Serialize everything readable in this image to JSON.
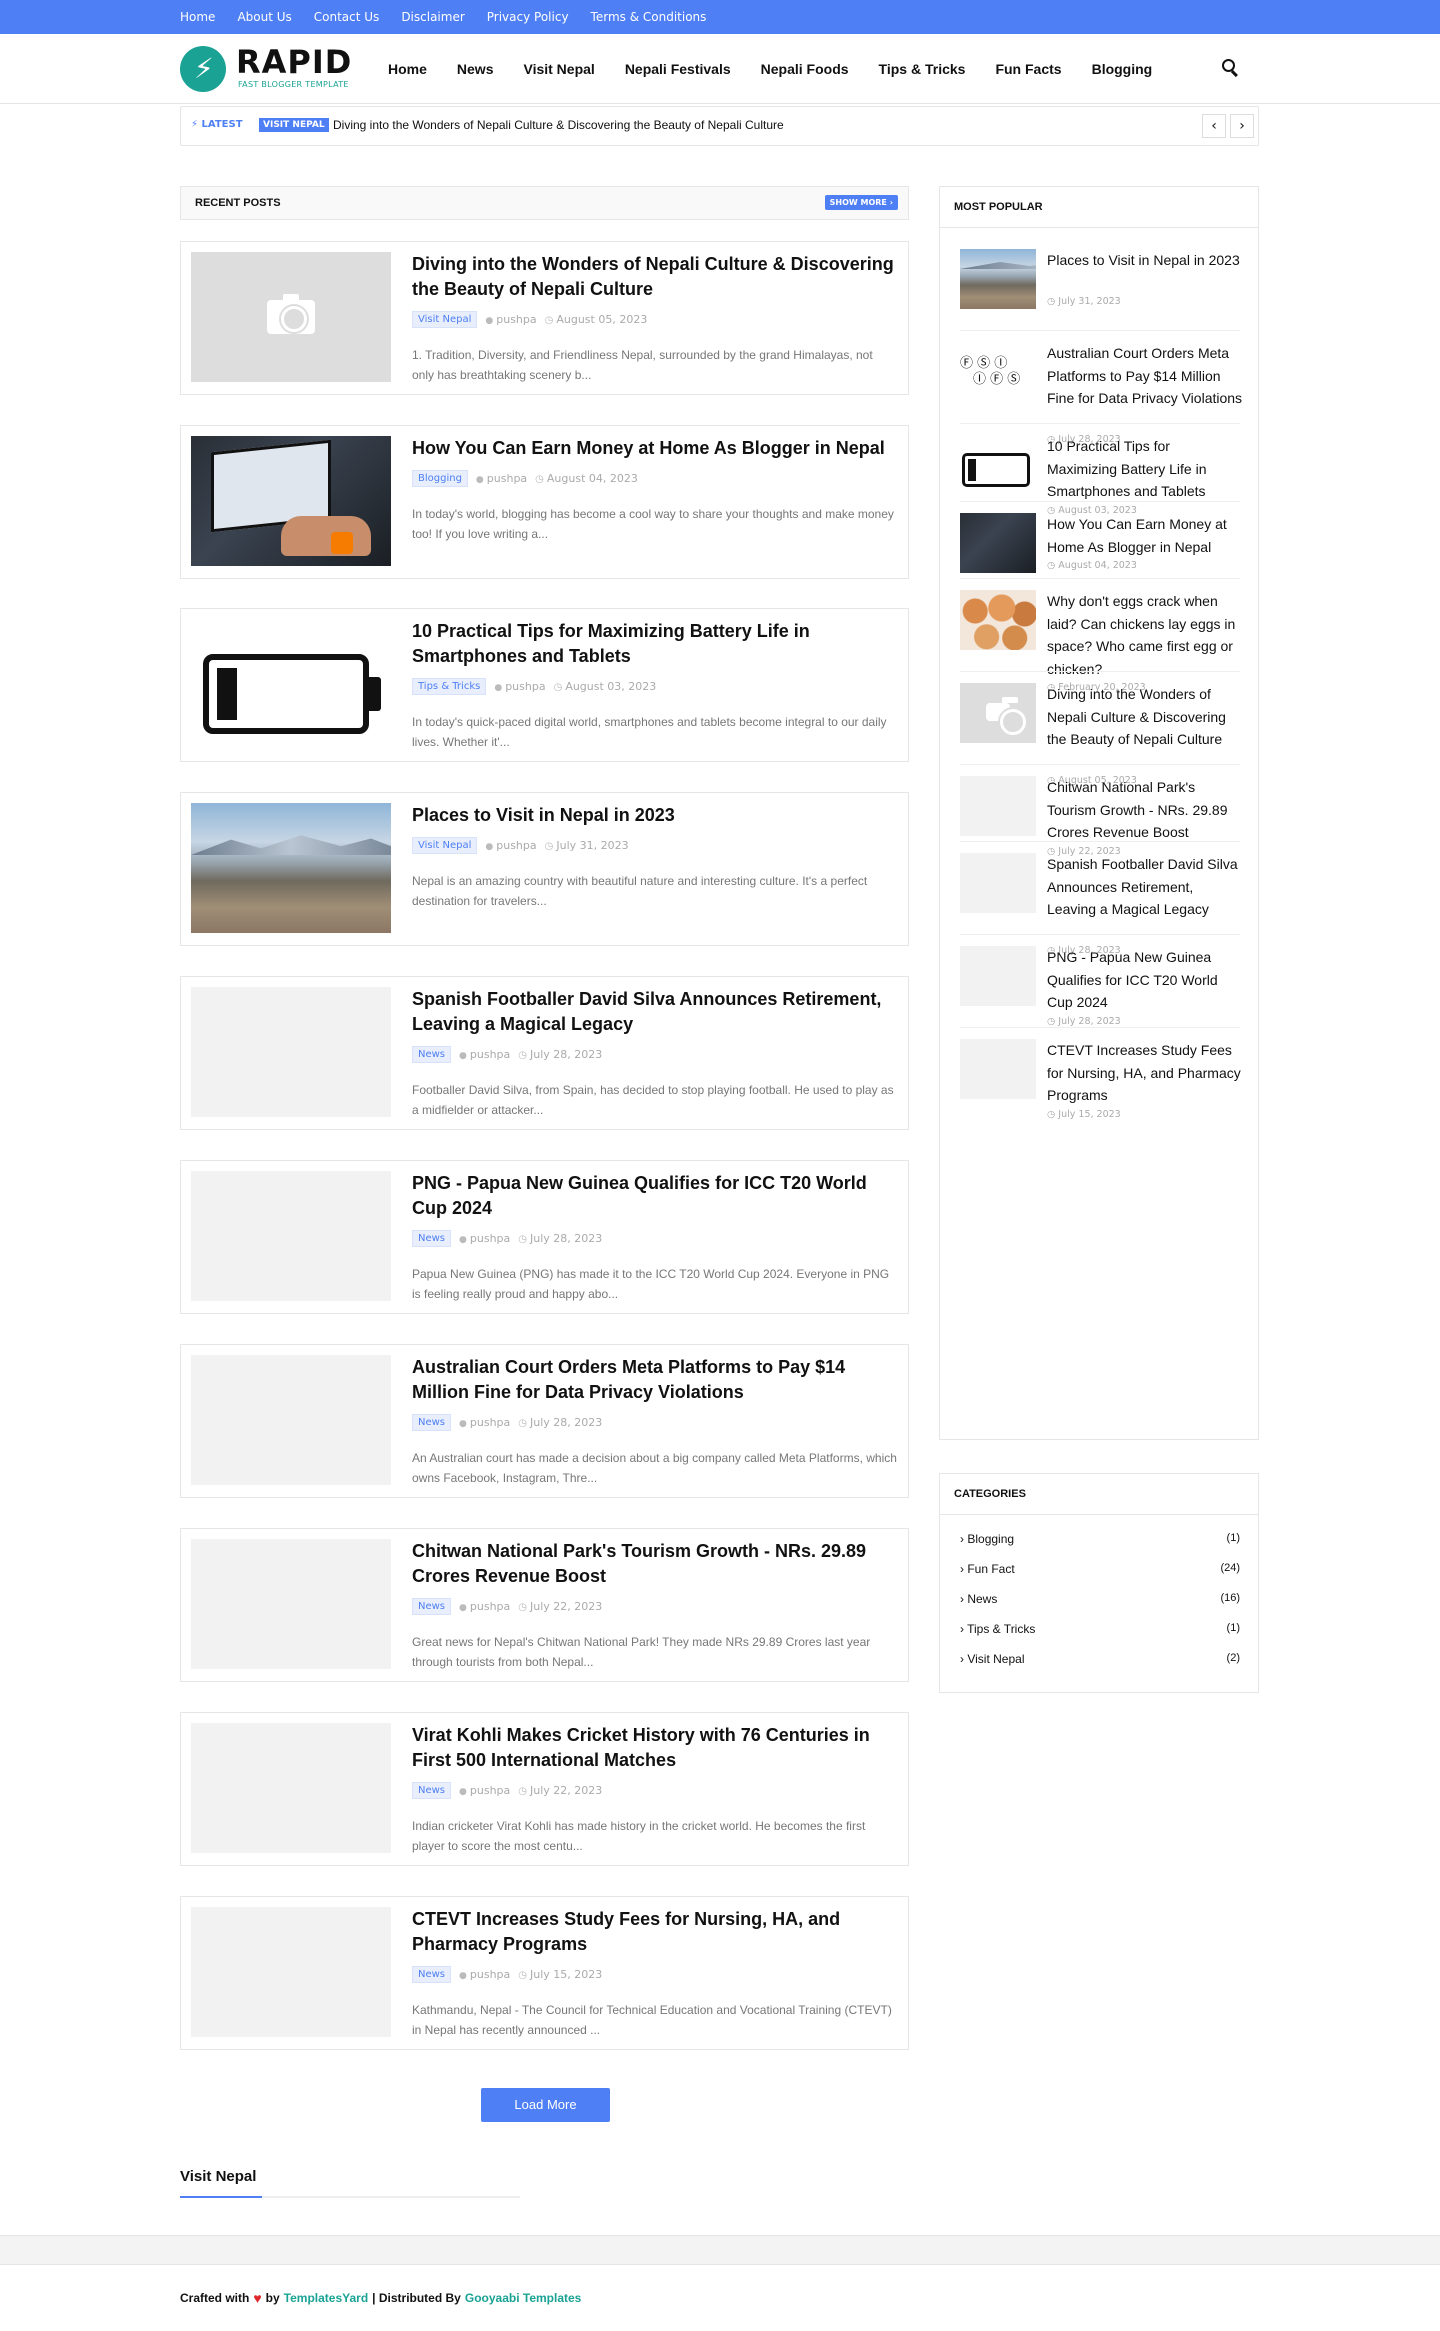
{
  "topbar": {
    "links": [
      "Home",
      "About Us",
      "Contact Us",
      "Disclaimer",
      "Privacy Policy",
      "Terms & Conditions"
    ]
  },
  "logo": {
    "title": "RAPID",
    "tagline": "FAST BLOGGER TEMPLATE"
  },
  "nav": {
    "items": [
      "Home",
      "News",
      "Visit Nepal",
      "Nepali Festivals",
      "Nepali Foods",
      "Tips & Tricks",
      "Fun Facts",
      "Blogging"
    ]
  },
  "ticker": {
    "latest_label": "LATEST",
    "tag": "VISIT NEPAL",
    "headline": "Diving into the Wonders of Nepali Culture & Discovering the Beauty of Nepali Culture",
    "prev_icon": "chevron-left-icon",
    "next_icon": "chevron-right-icon"
  },
  "recent": {
    "heading": "RECENT POSTS",
    "show_more": "SHOW MORE",
    "posts": [
      {
        "title": "Diving into the Wonders of Nepali Culture & Discovering the Beauty of Nepali Culture",
        "category": "Visit Nepal",
        "author": "pushpa",
        "date": "August 05, 2023",
        "snippet": "1. Tradition, Diversity, and Friendliness Nepal, surrounded by the grand Himalayas, not only has breathtaking scenery b...",
        "thumb": "camera-placeholder"
      },
      {
        "title": "How You Can Earn Money at Home As Blogger in Nepal",
        "category": "Blogging",
        "author": "pushpa",
        "date": "August 04, 2023",
        "snippet": "In today's world, blogging has become a cool way to share your thoughts and make money too! If you love writing a...",
        "thumb": "laptop"
      },
      {
        "title": "10 Practical Tips for Maximizing Battery Life in Smartphones and Tablets",
        "category": "Tips & Tricks",
        "author": "pushpa",
        "date": "August 03, 2023",
        "snippet": "In today's quick-paced digital world, smartphones and tablets become integral to our daily lives. Whether it'...",
        "thumb": "battery"
      },
      {
        "title": "Places to Visit in Nepal in 2023",
        "category": "Visit Nepal",
        "author": "pushpa",
        "date": "July 31, 2023",
        "snippet": "Nepal is an amazing country with beautiful nature and interesting culture. It's a perfect destination for travelers...",
        "thumb": "kathmandu"
      },
      {
        "title": "Spanish Footballer David Silva Announces Retirement, Leaving a Magical Legacy",
        "category": "News",
        "author": "pushpa",
        "date": "July 28, 2023",
        "snippet": "Footballer David Silva, from Spain, has decided to stop playing football. He used to play as a midfielder or attacker...",
        "thumb": "blank"
      },
      {
        "title": "PNG - Papua New Guinea Qualifies for ICC T20 World Cup 2024",
        "category": "News",
        "author": "pushpa",
        "date": "July 28, 2023",
        "snippet": "Papua New Guinea (PNG) has made it to the ICC T20 World Cup 2024. Everyone in PNG is feeling really proud and happy abo...",
        "thumb": "blank"
      },
      {
        "title": "Australian Court Orders Meta Platforms to Pay $14 Million Fine for Data Privacy Violations",
        "category": "News",
        "author": "pushpa",
        "date": "July 28, 2023",
        "snippet": "An Australian court has made a decision about a big company called Meta Platforms, which owns Facebook, Instagram, Thre...",
        "thumb": "blank"
      },
      {
        "title": "Chitwan National Park's Tourism Growth - NRs. 29.89 Crores Revenue Boost",
        "category": "News",
        "author": "pushpa",
        "date": "July 22, 2023",
        "snippet": "Great news for Nepal's Chitwan National Park! They made NRs 29.89 Crores last year through tourists from both Nepal...",
        "thumb": "blank"
      },
      {
        "title": "Virat Kohli Makes Cricket History with 76 Centuries in First 500 International Matches",
        "category": "News",
        "author": "pushpa",
        "date": "July 22, 2023",
        "snippet": "Indian cricketer Virat Kohli has made history in the cricket world. He becomes the first player to score the most centu...",
        "thumb": "blank"
      },
      {
        "title": "CTEVT Increases Study Fees for Nursing, HA, and Pharmacy Programs",
        "category": "News",
        "author": "pushpa",
        "date": "July 15, 2023",
        "snippet": "Kathmandu, Nepal - The Council for Technical Education and Vocational Training (CTEVT) in Nepal has recently announced ...",
        "thumb": "blank"
      }
    ]
  },
  "popular": {
    "heading": "MOST POPULAR",
    "items": [
      {
        "title": "Places to Visit in Nepal in 2023",
        "date": "July 31, 2023",
        "thumb": "kathmandu"
      },
      {
        "title": "Australian Court Orders Meta Platforms to Pay $14 Million Fine for Data Privacy Violations",
        "date": "July 28, 2023",
        "thumb": "social"
      },
      {
        "title": "10 Practical Tips for Maximizing Battery Life in Smartphones and Tablets",
        "date": "August 03, 2023",
        "thumb": "battery"
      },
      {
        "title": "How You Can Earn Money at Home As Blogger in Nepal",
        "date": "August 04, 2023",
        "thumb": "laptop"
      },
      {
        "title": "Why don't eggs crack when laid? Can chickens lay eggs in space? Who came first egg or chicken?",
        "date": "February 20, 2023",
        "thumb": "eggs"
      },
      {
        "title": "Diving into the Wonders of Nepali Culture & Discovering the Beauty of Nepali Culture",
        "date": "August 05, 2023",
        "thumb": "camera-placeholder"
      },
      {
        "title": "Chitwan National Park's Tourism Growth - NRs. 29.89 Crores Revenue Boost",
        "date": "July 22, 2023",
        "thumb": "blank"
      },
      {
        "title": "Spanish Footballer David Silva Announces Retirement, Leaving a Magical Legacy",
        "date": "July 28, 2023",
        "thumb": "blank"
      },
      {
        "title": "PNG - Papua New Guinea Qualifies for ICC T20 World Cup 2024",
        "date": "July 28, 2023",
        "thumb": "blank"
      },
      {
        "title": "CTEVT Increases Study Fees for Nursing, HA, and Pharmacy Programs",
        "date": "July 15, 2023",
        "thumb": "blank"
      }
    ]
  },
  "categories": {
    "heading": "CATEGORIES",
    "items": [
      {
        "label": "Blogging",
        "count": "(1)"
      },
      {
        "label": "Fun Fact",
        "count": "(24)"
      },
      {
        "label": "News",
        "count": "(16)"
      },
      {
        "label": "Tips & Tricks",
        "count": "(1)"
      },
      {
        "label": "Visit Nepal",
        "count": "(2)"
      }
    ]
  },
  "load_more": "Load More",
  "visit_section": "Visit Nepal",
  "footer": {
    "crafted": "Crafted with",
    "by": "by",
    "brand1": "TemplatesYard",
    "distributed": "| Distributed By",
    "brand2": "Gooyaabi Templates"
  },
  "colors": {
    "accent": "#4e7ff4",
    "brand": "#1aa394",
    "heart": "#e0262b"
  }
}
